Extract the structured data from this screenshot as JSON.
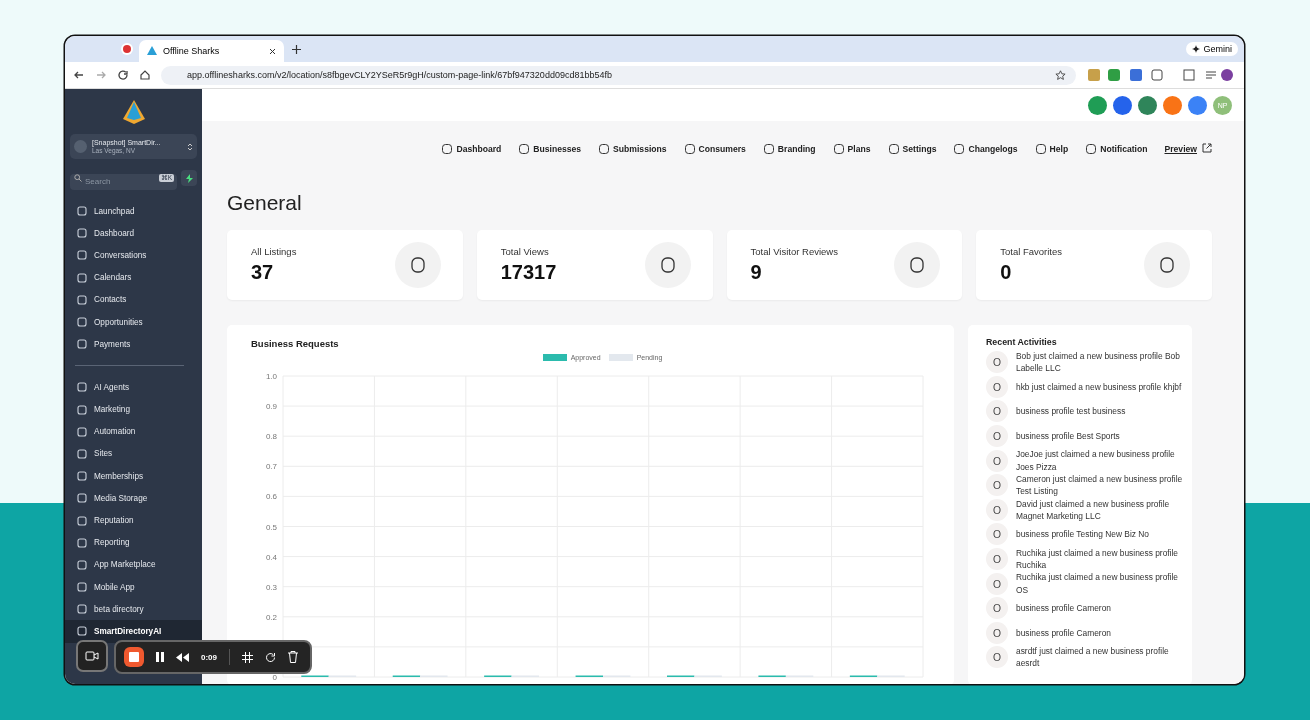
{
  "browser": {
    "tabs": [
      {
        "title": "Offline Sharks",
        "selected": true
      }
    ],
    "url": "app.offlinesharks.com/v2/location/s8fbgevCLY2YSeR5r9gH/custom-page-link/67bf947320dd09cd81bb54fb",
    "gemini": "Gemini"
  },
  "sidebar": {
    "account": {
      "name": "[Snapshot] SmartDir...",
      "location": "Las Vegas, NV"
    },
    "search": {
      "placeholder": "Search",
      "shortcut": "⌘K"
    },
    "groups": [
      [
        {
          "label": "Launchpad",
          "selected": false
        },
        {
          "label": "Dashboard",
          "selected": false
        },
        {
          "label": "Conversations",
          "selected": false
        },
        {
          "label": "Calendars",
          "selected": false
        },
        {
          "label": "Contacts",
          "selected": false
        },
        {
          "label": "Opportunities",
          "selected": false
        },
        {
          "label": "Payments",
          "selected": false
        }
      ],
      [
        {
          "label": "AI Agents",
          "selected": false
        },
        {
          "label": "Marketing",
          "selected": false
        },
        {
          "label": "Automation",
          "selected": false
        },
        {
          "label": "Sites",
          "selected": false
        },
        {
          "label": "Memberships",
          "selected": false
        },
        {
          "label": "Media Storage",
          "selected": false
        },
        {
          "label": "Reputation",
          "selected": false
        },
        {
          "label": "Reporting",
          "selected": false
        },
        {
          "label": "App Marketplace",
          "selected": false
        },
        {
          "label": "Mobile App",
          "selected": false
        },
        {
          "label": "beta directory",
          "selected": false
        },
        {
          "label": "SmartDirectoryAI",
          "selected": true
        }
      ]
    ]
  },
  "header": {
    "avatar": "NP"
  },
  "nav": {
    "items": [
      {
        "label": "Dashboard"
      },
      {
        "label": "Businesses"
      },
      {
        "label": "Submissions"
      },
      {
        "label": "Consumers"
      },
      {
        "label": "Branding"
      },
      {
        "label": "Plans"
      },
      {
        "label": "Settings"
      },
      {
        "label": "Changelogs"
      },
      {
        "label": "Help"
      },
      {
        "label": "Notification"
      }
    ],
    "preview": "Preview"
  },
  "page_title": "General",
  "stats": [
    {
      "label": "All Listings",
      "value": "37"
    },
    {
      "label": "Total Views",
      "value": "17317"
    },
    {
      "label": "Total Visitor Reviews",
      "value": "9"
    },
    {
      "label": "Total Favorites",
      "value": "0"
    }
  ],
  "requests": {
    "title": "Business Requests",
    "chart_data": {
      "type": "bar",
      "grid": true,
      "ylim": [
        0,
        1
      ],
      "yticks": [
        {
          "value": 0,
          "label": "0"
        },
        {
          "value": 0.2,
          "label": "0.2"
        },
        {
          "value": 0.3,
          "label": "0.3"
        },
        {
          "value": 0.4,
          "label": "0.4"
        },
        {
          "value": 0.5,
          "label": "0.5"
        },
        {
          "value": 0.6,
          "label": "0.6"
        },
        {
          "value": 0.7,
          "label": "0.7"
        },
        {
          "value": 0.8,
          "label": "0.8"
        },
        {
          "value": 0.9,
          "label": "0.9"
        },
        {
          "value": 1,
          "label": "1.0"
        }
      ],
      "series": [
        {
          "name": "Approved",
          "color": "#2bbbad",
          "values": [
            0,
            0,
            0,
            0,
            0,
            0,
            0
          ]
        },
        {
          "name": "Pending",
          "color": "#e3e8ee",
          "values": [
            0,
            0,
            0,
            0,
            0,
            0,
            0
          ]
        }
      ]
    }
  },
  "activities": {
    "title": "Recent Activities",
    "items": [
      {
        "text": "Bob just claimed a new business profile Bob Labelle LLC"
      },
      {
        "text": "hkb just claimed a new business profile khjbf"
      },
      {
        "text": "business profile test business"
      },
      {
        "text": "business profile Best Sports"
      },
      {
        "text": "JoeJoe just claimed a new business profile Joes Pizza"
      },
      {
        "text": "Cameron just claimed a new business profile Test Listing"
      },
      {
        "text": "David just claimed a new business profile Magnet Marketing LLC"
      },
      {
        "text": "business profile Testing New Biz No"
      },
      {
        "text": "Ruchika just claimed a new business profile Ruchika"
      },
      {
        "text": "Ruchika just claimed a new business profile OS"
      },
      {
        "text": "business profile Cameron"
      },
      {
        "text": "business profile Cameron"
      },
      {
        "text": "asrdtf just claimed a new business profile aesrdt"
      }
    ]
  },
  "recorder": {
    "time": "0:09"
  }
}
